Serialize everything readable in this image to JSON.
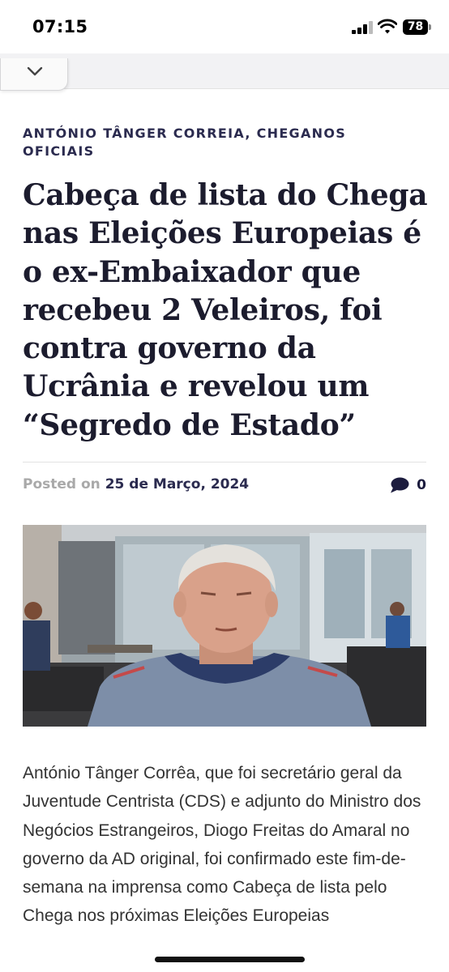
{
  "status_bar": {
    "time": "07:15",
    "battery": "78",
    "icons": [
      "signal-icon",
      "wifi-icon",
      "battery-icon"
    ]
  },
  "toolbar": {
    "icon": "chevron-down-icon"
  },
  "article": {
    "category": "ANTÓNIO TÂNGER CORREIA, CHEGANOS OFICIAIS",
    "headline": "Cabeça de lista do Chega nas Eleições Europeias é o ex-Embaixador que recebeu 2 Veleiros, foi contra governo da Ucrânia e revelou um “Segredo de Estado”",
    "posted_label": "Posted on",
    "date": "25 de Março, 2024",
    "comment_count": "0",
    "comment_icon": "comment-icon",
    "body": "António Tânger Corrêa, que foi secretário geral da Juventude Centrista (CDS) e adjunto do Ministro dos Negócios Estrangeiros, Diogo Freitas do Amaral no governo da AD original, foi confirmado este fim-de-semana na imprensa como Cabeça de lista pelo Chega nos próximas Eleições Europeias"
  },
  "colors": {
    "category": "#2b2b4f",
    "headline": "#1c1c2e",
    "meta_muted": "#a9a9a9",
    "body": "#333333"
  }
}
